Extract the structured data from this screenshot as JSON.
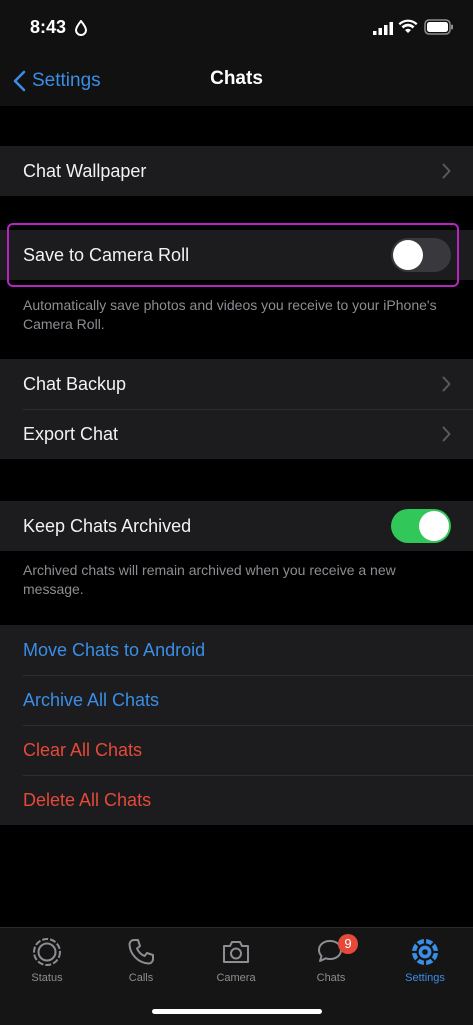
{
  "status_bar": {
    "time": "8:43"
  },
  "nav": {
    "back_label": "Settings",
    "title": "Chats"
  },
  "rows": {
    "chat_wallpaper": "Chat Wallpaper",
    "save_to_camera_roll": "Save to Camera Roll",
    "save_to_camera_roll_enabled": false,
    "chat_backup": "Chat Backup",
    "export_chat": "Export Chat",
    "keep_chats_archived": "Keep Chats Archived",
    "keep_chats_archived_enabled": true,
    "move_chats_to_android": "Move Chats to Android",
    "archive_all_chats": "Archive All Chats",
    "clear_all_chats": "Clear All Chats",
    "delete_all_chats": "Delete All Chats"
  },
  "footnotes": {
    "camera_roll": "Automatically save photos and videos you receive to your iPhone's Camera Roll.",
    "archived": "Archived chats will remain archived when you receive a new message."
  },
  "tabs": [
    {
      "label": "Status",
      "icon": "status-icon"
    },
    {
      "label": "Calls",
      "icon": "phone-icon"
    },
    {
      "label": "Camera",
      "icon": "camera-icon"
    },
    {
      "label": "Chats",
      "icon": "chat-bubbles-icon",
      "badge": "9"
    },
    {
      "label": "Settings",
      "icon": "settings-gear-icon",
      "active": true
    }
  ],
  "colors": {
    "accent_blue": "#3a8ee6",
    "destructive_red": "#e5493a",
    "toggle_on": "#31c859",
    "highlight_purple": "#b525c3"
  }
}
